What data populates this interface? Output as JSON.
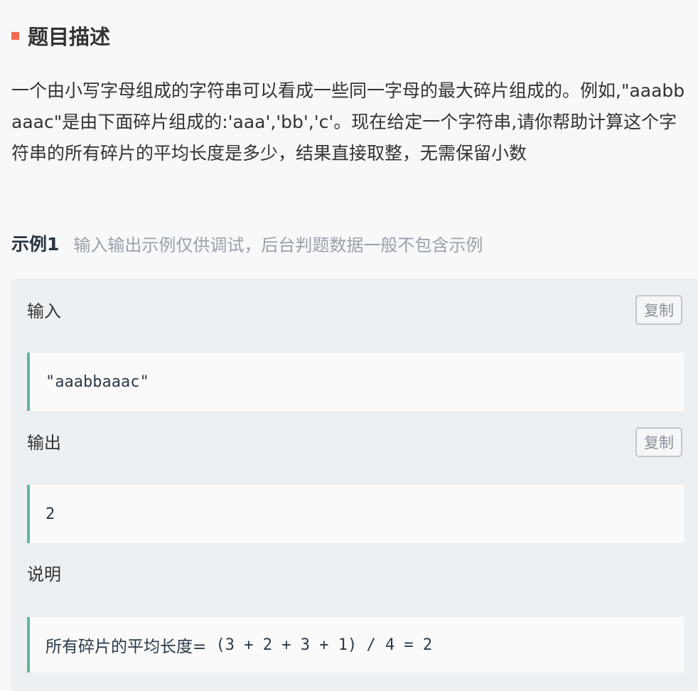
{
  "problem": {
    "section_title": "题目描述",
    "description": "一个由小写字母组成的字符串可以看成一些同一字母的最大碎片组成的。例如,\"aaabbaaac\"是由下面碎片组成的:'aaa','bb','c'。现在给定一个字符串,请你帮助计算这个字符串的所有碎片的平均长度是多少，结果直接取整，无需保留小数"
  },
  "example": {
    "label": "示例1",
    "note": "输入输出示例仅供调试，后台判题数据一般不包含示例",
    "input_label": "输入",
    "input_value": "\"aaabbaaac\"",
    "output_label": "输出",
    "output_value": "2",
    "explain_label": "说明",
    "explain_text": "所有碎片的平均长度=",
    "explain_formula": " (3 + 2 + 3 + 1) / 4 = 2",
    "copy_label": "复制"
  },
  "colors": {
    "title_marker": "#f36a4f",
    "code_accent": "#5cb99a",
    "example_bg": "#edf0f3"
  }
}
